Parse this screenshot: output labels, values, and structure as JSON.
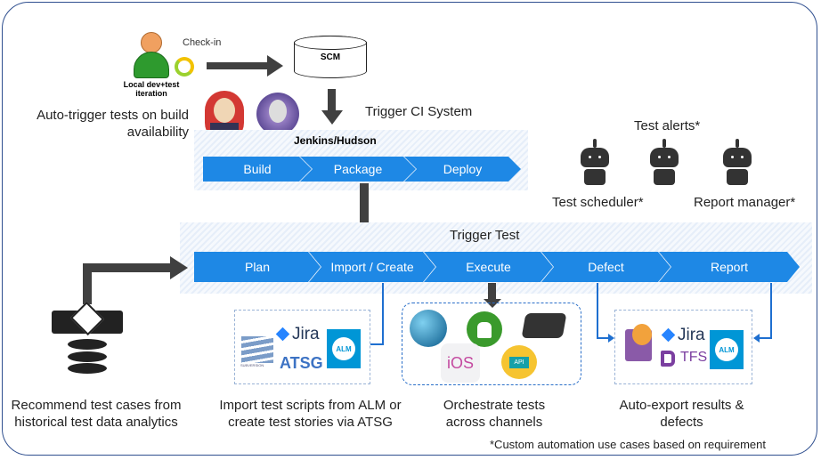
{
  "labels": {
    "check_in": "Check-in",
    "scm": "SCM",
    "local_dev": "Local dev+test iteration",
    "auto_trigger": "Auto-trigger tests on build availability",
    "trigger_ci": "Trigger CI System",
    "jenkins": "Jenkins/Hudson",
    "test_alerts": "Test alerts*",
    "test_scheduler": "Test scheduler*",
    "report_manager": "Report manager*",
    "trigger_test": "Trigger Test",
    "recommend": "Recommend test cases from historical test data analytics",
    "import_scripts": "Import test scripts from ALM or create test stories via ATSG",
    "orchestrate": "Orchestrate tests across channels",
    "auto_export": "Auto-export results & defects",
    "footnote": "*Custom automation use cases based on requirement"
  },
  "ci_stages": [
    "Build",
    "Package",
    "Deploy"
  ],
  "test_stages": [
    "Plan",
    "Import / Create",
    "Execute",
    "Defect",
    "Report"
  ],
  "tools": {
    "jira": "Jira",
    "atsg": "ATSG",
    "alm": "ALM",
    "ios": "iOS",
    "api": "API",
    "tfs": "TFS",
    "subversion": "SUBVERSION"
  },
  "colors": {
    "accent": "#1e88e5",
    "frame": "#2f4f8f",
    "arrow": "#404040"
  }
}
